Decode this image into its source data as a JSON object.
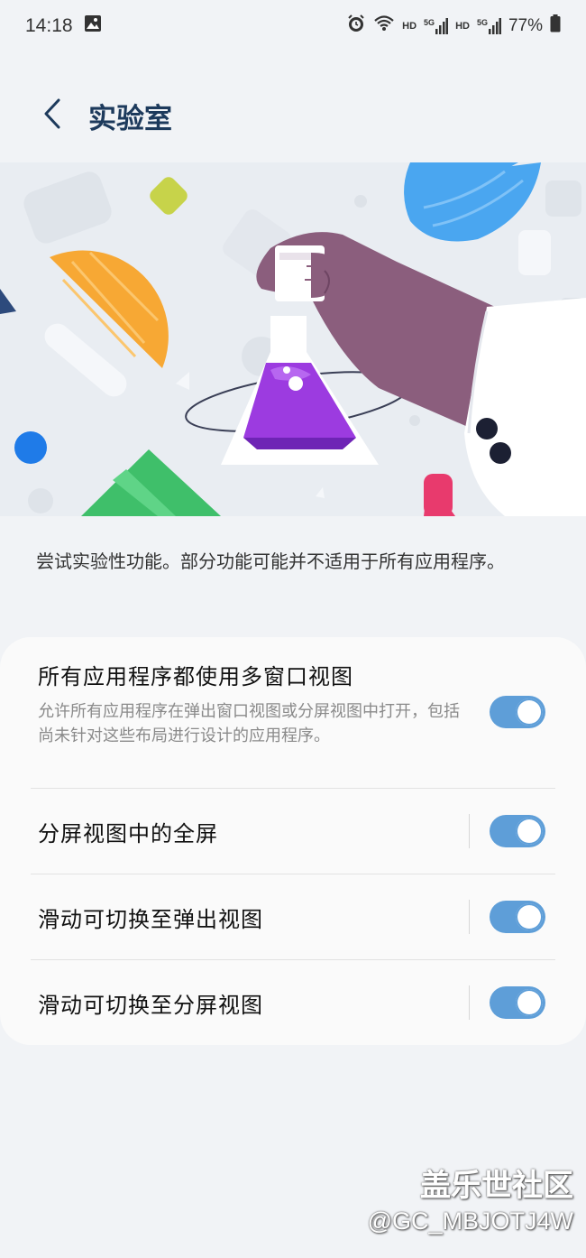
{
  "status_bar": {
    "time": "14:18",
    "hd1": "HD",
    "hd2": "HD",
    "net1": "5G",
    "net2": "5G",
    "battery": "77%"
  },
  "header": {
    "title": "实验室"
  },
  "description": "尝试实验性功能。部分功能可能并不适用于所有应用程序。",
  "settings": [
    {
      "title": "所有应用程序都使用多窗口视图",
      "subtitle": "允许所有应用程序在弹出窗口视图或分屏视图中打开，包括尚未针对这些布局进行设计的应用程序。",
      "enabled": true
    },
    {
      "title": "分屏视图中的全屏",
      "enabled": true
    },
    {
      "title": "滑动可切换至弹出视图",
      "enabled": true
    },
    {
      "title": "滑动可切换至分屏视图",
      "enabled": true
    }
  ],
  "watermark": {
    "brand": "盖乐世社区",
    "user": "@GC_MBJOTJ4W"
  },
  "colors": {
    "accent": "#5e9ed8",
    "title": "#1d3a5c",
    "background": "#f1f3f6"
  }
}
